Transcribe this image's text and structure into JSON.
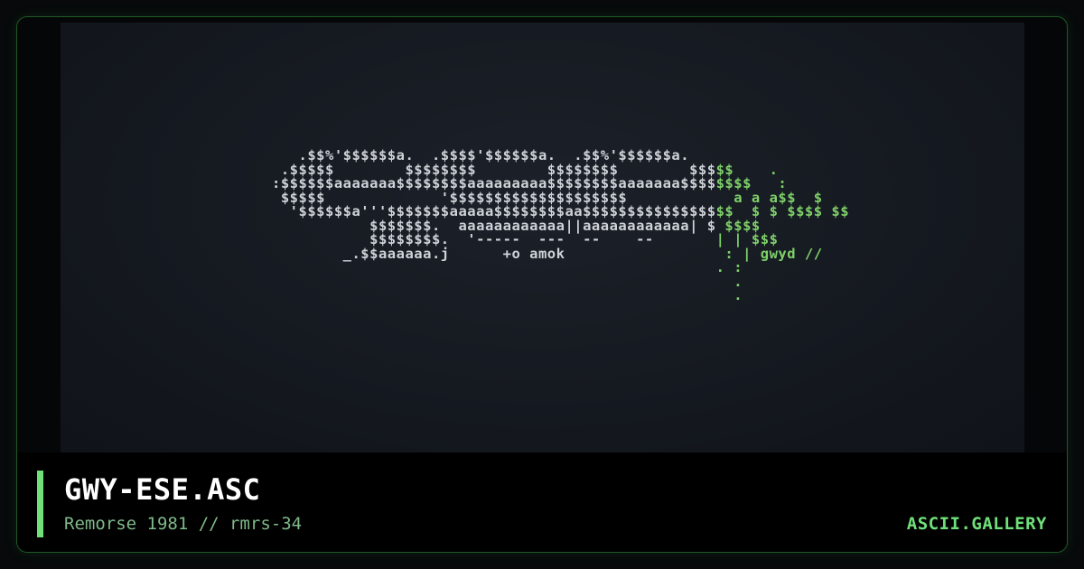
{
  "art": {
    "lines": [
      "         .$$%'$$$$$$a.  .$$$$'$$$$$$a.  .$$%'$$$$$$a.",
      "       .$$$$$        $$$$$$$$        $$$$$$$$        $$$$$    .",
      "      :$$$$$$aaaaaaa$$$$$$$$aaaaaaaaa$$$$$$$$aaaaaaa$$$$$$$$   :",
      "       $$$$$             '$$$$$$$$$$$$$$$$$$$$            a a a$$  $",
      "        '$$$$$$a'''$$$$$$$aaaaa$$$$$$$$aa$$$$$$$$$$$$$$$$$  $ $ $$$$ $$",
      "                 $$$$$$$.  aaaaaaaaaaaa||aaaaaaaaaaaa| $ $$$$",
      "                 $$$$$$$$.  '-----  ---  --    --       | | $$$",
      "              _.$$aaaaaa.j      +o amok                  : | gwyd //",
      "                                                        . :",
      "                                                          .",
      "                                                          ."
    ]
  },
  "footer": {
    "title": "GWY-ESE.ASC",
    "subtitle": "Remorse 1981 // rmrs-34",
    "brand": "ASCII.GALLERY"
  },
  "colors": {
    "accent": "#6fe07a",
    "card_border": "#1f5a26",
    "subtitle": "#7fb98a",
    "art_text": "#cfd3d8",
    "art_green": "#7fd16a"
  }
}
